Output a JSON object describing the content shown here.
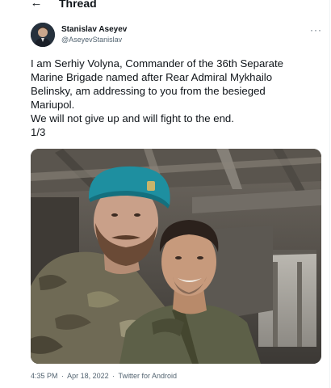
{
  "header": {
    "back_icon": "arrow-left-icon",
    "title": "Thread"
  },
  "tweet": {
    "author_name": "Stanislav Aseyev",
    "author_handle": "@AseyevStanislav",
    "more_icon": "more-horizontal-icon",
    "text_lines": [
      "I am Serhiy Volyna, Commander of the 36th Separate",
      "Marine Brigade named after Rear Admiral Mykhailo",
      "Belinsky, am addressing to you from the besieged",
      "Mariupol.",
      "We will not give up and will fight to the end.",
      "1/3"
    ],
    "time": "4:35 PM",
    "date": "Apr 18, 2022",
    "separator": "·",
    "source": "Twitter for Android"
  },
  "colors": {
    "text_primary": "#0f1419",
    "text_secondary": "#536471",
    "beret": "#1e8fa0"
  }
}
